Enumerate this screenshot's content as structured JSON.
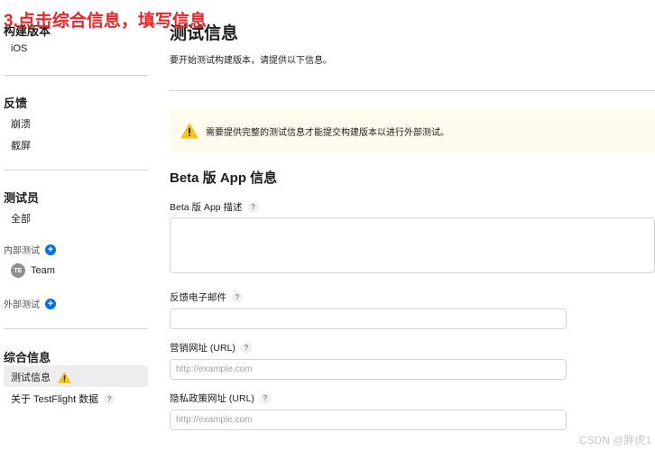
{
  "annotation": "3.点击综合信息，填写信息",
  "sidebar": {
    "build_section": {
      "heading": "构建版本",
      "items": [
        {
          "label": "iOS"
        }
      ]
    },
    "feedback_section": {
      "heading": "反馈",
      "items": [
        {
          "label": "崩溃"
        },
        {
          "label": "截屏"
        }
      ]
    },
    "testers_section": {
      "heading": "测试员",
      "all_label": "全部",
      "internal_label": "内部测试",
      "team": {
        "avatar_initials": "TE",
        "label": "Team"
      },
      "external_label": "外部测试"
    },
    "general_section": {
      "heading": "综合信息",
      "items": [
        {
          "label": "测试信息",
          "active": true
        },
        {
          "label": "关于 TestFlight 数据"
        }
      ]
    }
  },
  "main": {
    "title": "测试信息",
    "description": "要开始测试构建版本，请提供以下信息。",
    "warning_text": "需要提供完整的测试信息才能提交构建版本以进行外部测试。",
    "section_title": "Beta 版 App 信息",
    "fields": {
      "beta_description": {
        "label": "Beta 版 App 描述",
        "value": ""
      },
      "feedback_email": {
        "label": "反馈电子邮件",
        "value": ""
      },
      "marketing_url": {
        "label": "营销网址 (URL)",
        "placeholder": "http://example.com"
      },
      "privacy_url": {
        "label": "隐私政策网址 (URL)",
        "placeholder": "http://example.com"
      }
    },
    "help_glyph": "?"
  },
  "watermark": "CSDN @胖虎1",
  "colors": {
    "accent": "#0071e3",
    "warning": "#f5c518",
    "annotation": "#e8262a",
    "banner_bg": "#fefaee"
  },
  "icons": {
    "plus": "+",
    "warning": "warning-triangle-icon",
    "help": "question-mark-icon"
  }
}
